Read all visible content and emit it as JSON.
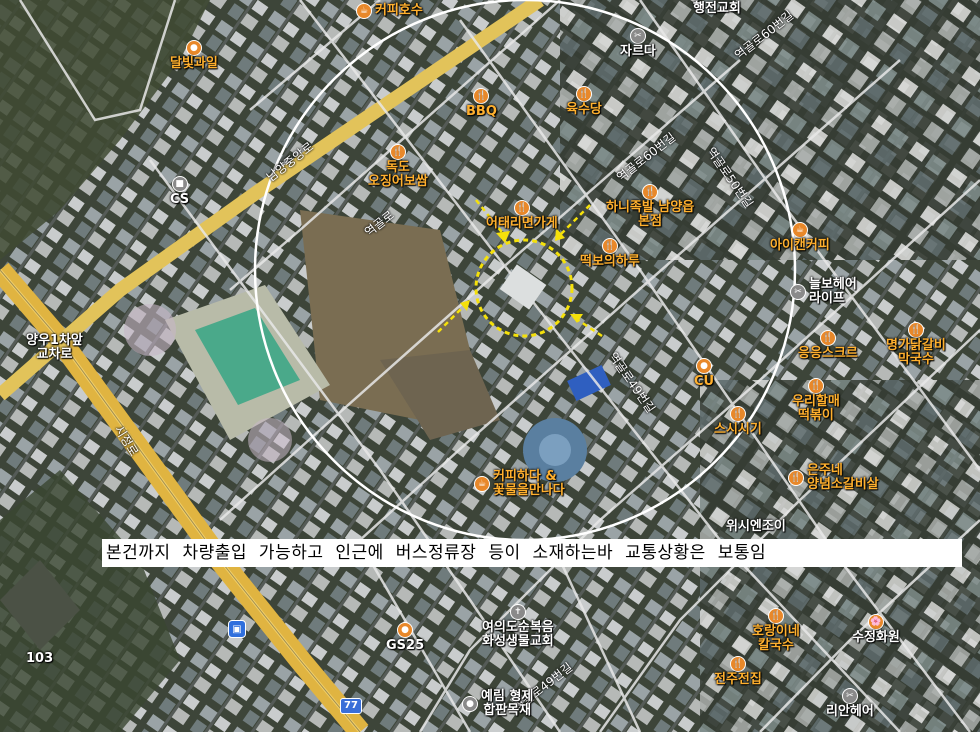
{
  "caption": "본건까지 차량출입 가능하고 인근에 버스정류장 등이 소재하는바 교통상황은 보통임",
  "colors": {
    "poi_label": "#ffb02e",
    "food_pin": "#e8882a",
    "shop_pin": "#8a8a8a",
    "circle": "#ffffff",
    "subject_marker": "#f5e10a"
  },
  "pois": [
    {
      "id": "coffee-hosu",
      "label": "커피호수",
      "icon": "coffee-icon"
    },
    {
      "id": "dalbit-fruit",
      "label": "달빛과일",
      "icon": "shop-icon"
    },
    {
      "id": "haengjeon-church",
      "label": "행전교회",
      "icon": ""
    },
    {
      "id": "jareuda",
      "label": "자르다",
      "icon": "scissors-icon"
    },
    {
      "id": "bbq",
      "label": "BBQ",
      "icon": "food-icon"
    },
    {
      "id": "yuksudang",
      "label": "육수당",
      "icon": "food-icon"
    },
    {
      "id": "dokdo",
      "label": "독도\n오징어보쌈",
      "icon": "food-icon"
    },
    {
      "id": "cs",
      "label": "CS",
      "icon": "shop-icon"
    },
    {
      "id": "eotaeri",
      "label": "어태리면가게",
      "icon": "food-icon"
    },
    {
      "id": "hanny-jokbal",
      "label": "하니족발 남양읍\n본점",
      "icon": "food-icon"
    },
    {
      "id": "ddeokbo",
      "label": "떡보의하루",
      "icon": "food-icon"
    },
    {
      "id": "icancoffee",
      "label": "아이캔커피",
      "icon": "coffee-icon"
    },
    {
      "id": "neulbo-hair",
      "label": "늘보헤어\n라이프",
      "icon": "shop-icon"
    },
    {
      "id": "myeongga",
      "label": "명가닭갈비\n막국수",
      "icon": "food-icon"
    },
    {
      "id": "eungeung",
      "label": "응응스크르",
      "icon": "food-icon"
    },
    {
      "id": "cu",
      "label": "CU",
      "icon": "shop-icon"
    },
    {
      "id": "uri-halmae",
      "label": "우리할매\n떡볶이",
      "icon": "food-icon"
    },
    {
      "id": "susisigi",
      "label": "스시시기",
      "icon": "food-icon"
    },
    {
      "id": "eunjune",
      "label": "은주네\n양념소갈비살",
      "icon": "food-icon"
    },
    {
      "id": "coffee-hada",
      "label": "커피하다 &\n꽃물을만나다",
      "icon": "coffee-icon"
    },
    {
      "id": "gs25",
      "label": "GS25",
      "icon": "shop-icon"
    },
    {
      "id": "yeoui",
      "label": "여의도순복음\n화성생물교회",
      "icon": "church-icon"
    },
    {
      "id": "horangine",
      "label": "호랑이네\n칼국수",
      "icon": "food-icon"
    },
    {
      "id": "jeonju",
      "label": "전주전집",
      "icon": "food-icon"
    },
    {
      "id": "sujeong",
      "label": "수정화원",
      "icon": "food-icon"
    },
    {
      "id": "rian-hair",
      "label": "리안헤어",
      "icon": "shop-icon"
    },
    {
      "id": "yerim",
      "label": "예림 형제\n합판목재",
      "icon": "shop-icon"
    },
    {
      "id": "yangu",
      "label": "양우1차앞\n교차로",
      "icon": ""
    },
    {
      "id": "num103",
      "label": "103",
      "icon": ""
    },
    {
      "id": "wishiyan",
      "label": "위시엔조이",
      "icon": ""
    }
  ],
  "roads": [
    {
      "id": "namyang-jungang-ro",
      "label": "남양중앙로"
    },
    {
      "id": "sijeong-ro",
      "label": "시정로"
    },
    {
      "id": "yeokgol-ro",
      "label": "역골로"
    },
    {
      "id": "yeokgol-60-gil-a",
      "label": "역골로60번길"
    },
    {
      "id": "yeokgol-60-gil-b",
      "label": "역골로60번길"
    },
    {
      "id": "yeokgol-50-gil",
      "label": "역골로50번길"
    },
    {
      "id": "yeokgol-49-gil-a",
      "label": "역골로49번길"
    },
    {
      "id": "yeokgol-49-gil-b",
      "label": "역골로49번길"
    }
  ],
  "route_shield": "77"
}
